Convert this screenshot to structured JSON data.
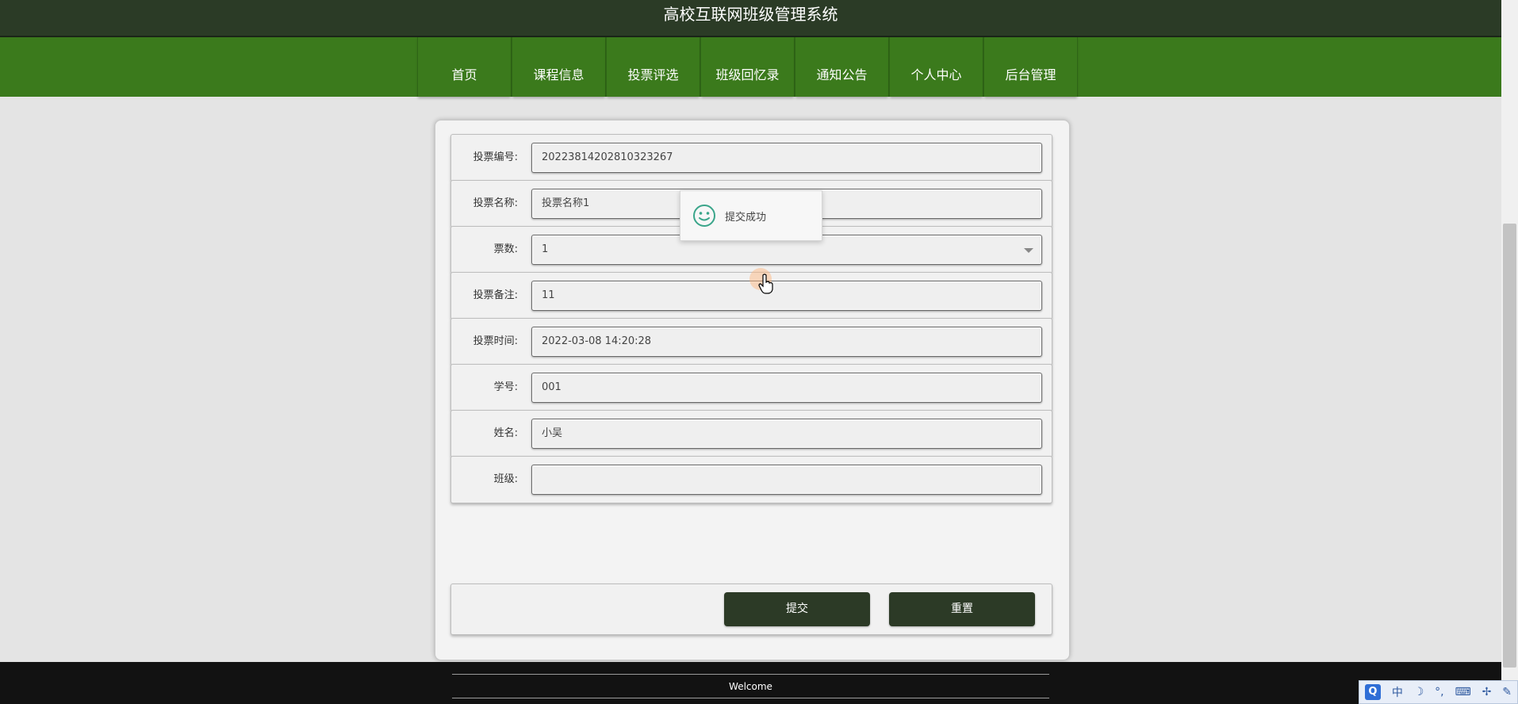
{
  "header": {
    "title": "高校互联网班级管理系统"
  },
  "nav": {
    "items": [
      {
        "label": "首页"
      },
      {
        "label": "课程信息"
      },
      {
        "label": "投票评选"
      },
      {
        "label": "班级回忆录"
      },
      {
        "label": "通知公告"
      },
      {
        "label": "个人中心"
      },
      {
        "label": "后台管理"
      }
    ]
  },
  "form": {
    "fields": [
      {
        "label": "投票编号:",
        "value": "20223814202810323267"
      },
      {
        "label": "投票名称:",
        "value": "投票名称1"
      },
      {
        "label": "票数:",
        "value": "1"
      },
      {
        "label": "投票备注:",
        "value": "11"
      },
      {
        "label": "投票时间:",
        "value": "2022-03-08 14:20:28"
      },
      {
        "label": "学号:",
        "value": "001"
      },
      {
        "label": "姓名:",
        "value": "小吴"
      },
      {
        "label": "班级:",
        "value": ""
      }
    ],
    "submit_label": "提交",
    "reset_label": "重置"
  },
  "toast": {
    "text": "提交成功",
    "icon": "smile-icon"
  },
  "footer": {
    "text": "Welcome"
  },
  "ime": {
    "q": "Q",
    "mode": "中",
    "moon": "☽",
    "punct": "°,",
    "keyboard": "⌨",
    "tool1": "✢",
    "tool2": "✎"
  },
  "colors": {
    "topbar": "#2b3b26",
    "navbar": "#3b7a1c",
    "button": "#2c3a26",
    "toast_icon": "#3aa58a"
  }
}
